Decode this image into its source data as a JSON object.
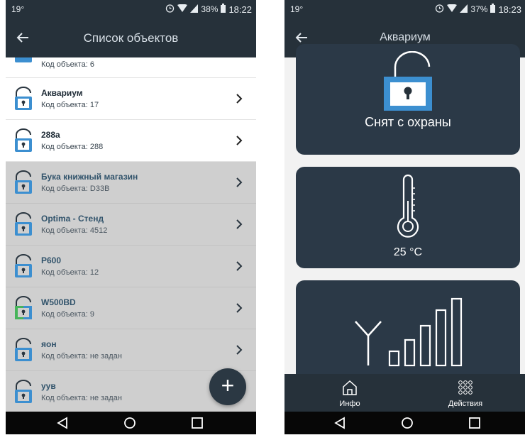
{
  "left": {
    "status_bar": {
      "temp": "19°",
      "battery": "38%",
      "time": "18:22"
    },
    "title": "Список объектов",
    "partial_row": {
      "code": "Код объекта: 6"
    },
    "items": [
      {
        "name": "Аквариум",
        "code": "Код объекта: 17",
        "state": "armed-off"
      },
      {
        "name": "288a",
        "code": "Код объекта: 288",
        "state": "armed-off"
      },
      {
        "name": "Бука книжный магазин",
        "code": "Код объекта: D33B",
        "state": "offline"
      },
      {
        "name": "Optima - Стенд",
        "code": "Код объекта: 4512",
        "state": "offline"
      },
      {
        "name": "P600",
        "code": "Код объекта: 12",
        "state": "offline"
      },
      {
        "name": "W500BD",
        "code": "Код объекта: 9",
        "state": "partial"
      },
      {
        "name": "яон",
        "code": "Код объекта: не задан",
        "state": "offline"
      },
      {
        "name": "уув",
        "code": "Код объекта: не задан",
        "state": "offline"
      }
    ],
    "fab_label": "+"
  },
  "right": {
    "status_bar": {
      "temp": "19°",
      "battery": "37%",
      "time": "18:23"
    },
    "title": "Аквариум",
    "status_text": "Снят с охраны",
    "temperature": "25 °C",
    "tabs": [
      {
        "label": "Инфо",
        "icon": "home-icon"
      },
      {
        "label": "Действия",
        "icon": "grid-dots-icon"
      }
    ]
  },
  "colors": {
    "header": "#26313a",
    "card": "#2b3947",
    "lock_blue": "#3c8fd0",
    "lock_green": "#47b45a",
    "row_offline": "#cfcfcf"
  }
}
